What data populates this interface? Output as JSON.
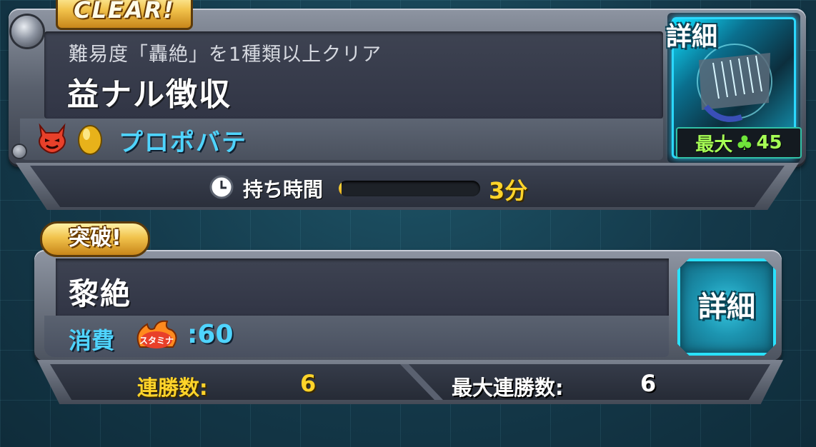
{
  "quest_card": {
    "clear_badge": "CLEAR!",
    "condition": "難易度「轟絶」を1種類以上クリア",
    "title": "益ナル徴収",
    "boss_name": "プロポバテ",
    "detail_label": "詳細",
    "max_luck_label": "最大",
    "max_luck_value": "45",
    "icons": [
      "devil-element-icon",
      "egg-icon",
      "clover-icon"
    ]
  },
  "time_limit": {
    "label": "持ち時間",
    "value": "3分",
    "fill_fraction": 0.02
  },
  "breakthrough_card": {
    "badge": "突破!",
    "title": "黎絶",
    "cost_label": "消費",
    "stamina_icon_text": "スタミナ",
    "cost_value": ":60",
    "detail_label": "詳細"
  },
  "streak": {
    "wins_label": "連勝数:",
    "wins_value": "6",
    "max_wins_label": "最大連勝数:",
    "max_wins_value": "6"
  },
  "colors": {
    "accent_cyan": "#4fd4ff",
    "accent_gold": "#ffd42a",
    "luck_green": "#a6ff55"
  }
}
